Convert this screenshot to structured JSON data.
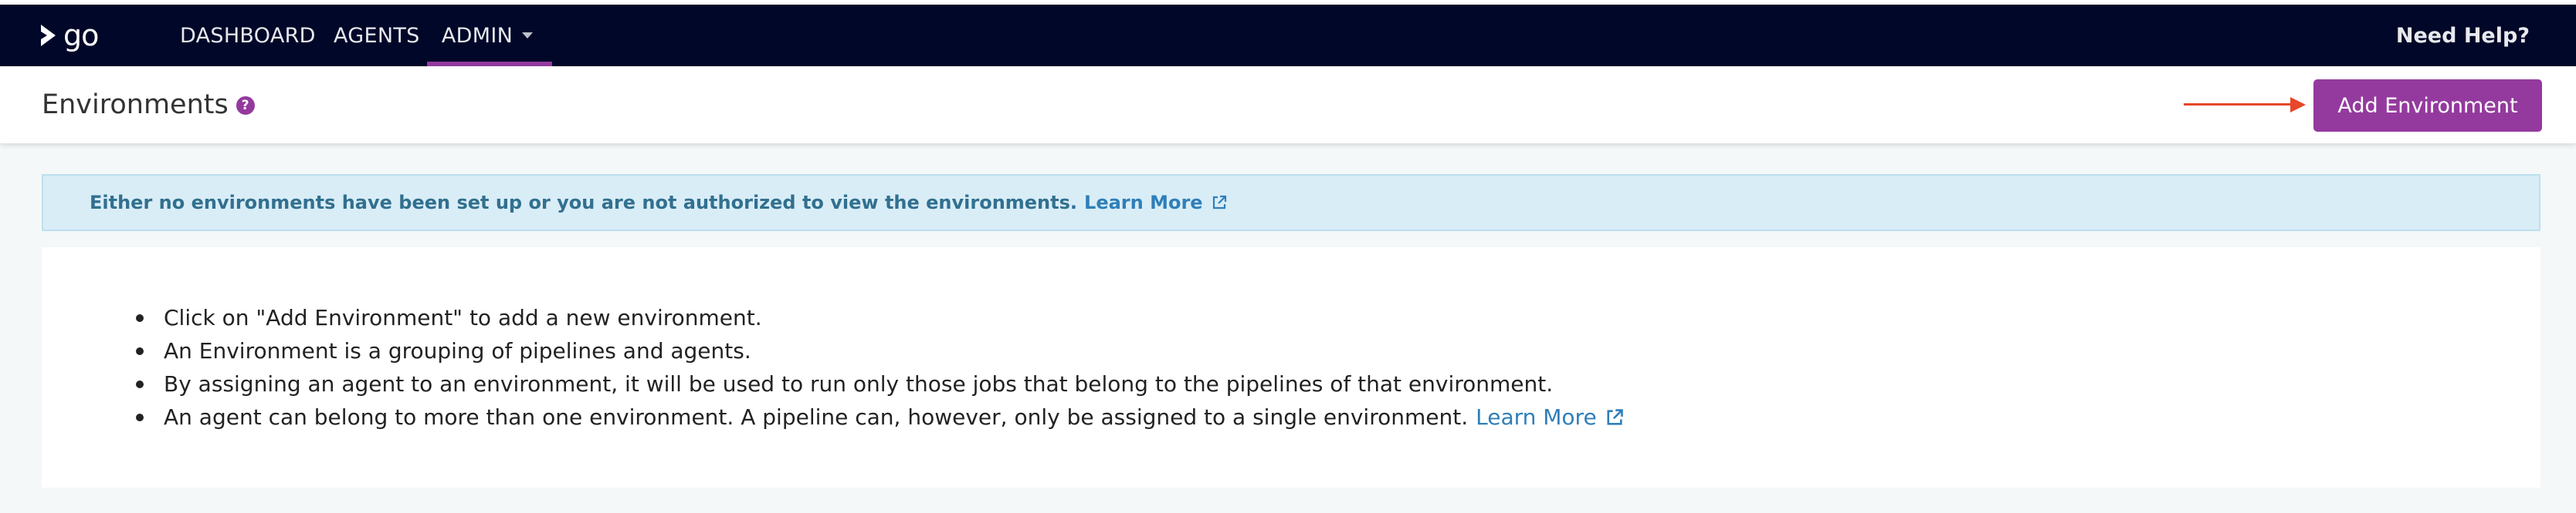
{
  "nav": {
    "logo_text": "go",
    "items": [
      {
        "label": "DASHBOARD"
      },
      {
        "label": "AGENTS"
      },
      {
        "label": "ADMIN"
      }
    ],
    "active": "ADMIN",
    "help": "Need Help?"
  },
  "header": {
    "title": "Environments",
    "help_icon_glyph": "?",
    "add_button": "Add Environment"
  },
  "alert": {
    "message": "Either no environments have been set up or you are not authorized to view the environments.",
    "link": "Learn More"
  },
  "info": {
    "items": [
      "Click on \"Add Environment\" to add a new environment.",
      "An Environment is a grouping of pipelines and agents.",
      "By assigning an agent to an environment, it will be used to run only those jobs that belong to the pipelines of that environment.",
      "An agent can belong to more than one environment. A pipeline can, however, only be assigned to a single environment."
    ],
    "link": "Learn More"
  },
  "colors": {
    "navbar_bg": "#000728",
    "accent": "#943a9e",
    "alert_bg": "#d9edf7",
    "link": "#2f7fb9",
    "arrow": "#e8472a"
  },
  "icons": {
    "logo": "gocd-logo-icon",
    "help": "question-circle-icon",
    "external": "external-link-icon",
    "caret": "caret-down-icon"
  }
}
